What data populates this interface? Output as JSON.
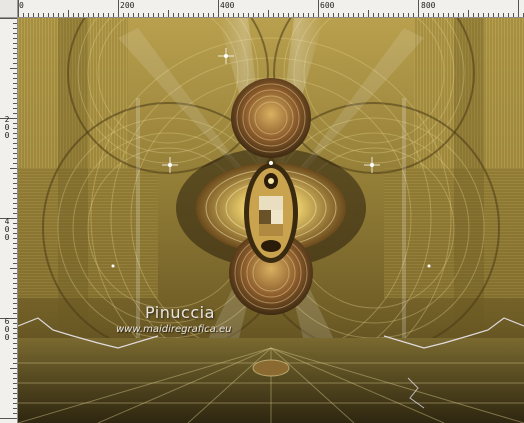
{
  "rulers": {
    "horizontal_labels": [
      "0",
      "200",
      "400",
      "600",
      "800"
    ],
    "vertical_labels": [
      "200",
      "400",
      "600"
    ]
  },
  "artwork": {
    "signature": "Pinuccia",
    "website": "www.maidiregrafica.eu",
    "colors": {
      "gold_light": "#d6c276",
      "gold_mid": "#a8923e",
      "gold_dark": "#5e4a1c",
      "olive": "#8a7a34",
      "brown": "#6b4a24",
      "highlight": "#f4efd6"
    }
  }
}
